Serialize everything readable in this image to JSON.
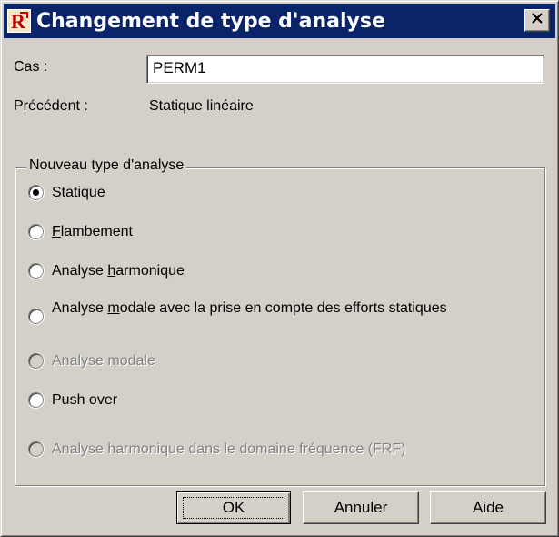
{
  "window": {
    "title": "Changement de type d'analyse",
    "close_glyph": "×"
  },
  "fields": {
    "cas_label": "Cas :",
    "cas_value": "PERM1",
    "precedent_label": "Précédent :",
    "precedent_value": "Statique linéaire"
  },
  "group": {
    "title": "Nouveau type d'analyse",
    "options": [
      {
        "pre": "",
        "accel": "S",
        "post": "tatique",
        "checked": true,
        "disabled": false
      },
      {
        "pre": "",
        "accel": "F",
        "post": "lambement",
        "checked": false,
        "disabled": false
      },
      {
        "pre": "Analyse ",
        "accel": "h",
        "post": "armonique",
        "checked": false,
        "disabled": false
      },
      {
        "pre": "Analyse ",
        "accel": "m",
        "post": "odale avec la prise en compte des efforts statiques",
        "checked": false,
        "disabled": false
      },
      {
        "pre": "Analyse modale",
        "accel": "",
        "post": "",
        "checked": false,
        "disabled": true
      },
      {
        "pre": "Push over",
        "accel": "",
        "post": "",
        "checked": false,
        "disabled": false
      },
      {
        "pre": "Analyse harmonique dans le domaine fréquence (FRF)",
        "accel": "",
        "post": "",
        "checked": false,
        "disabled": true
      }
    ]
  },
  "buttons": {
    "ok": "OK",
    "cancel": "Annuler",
    "help": "Aide"
  },
  "colors": {
    "titlebar": "#0a246a",
    "face": "#d4d0c8",
    "disabled_text": "#808080"
  }
}
